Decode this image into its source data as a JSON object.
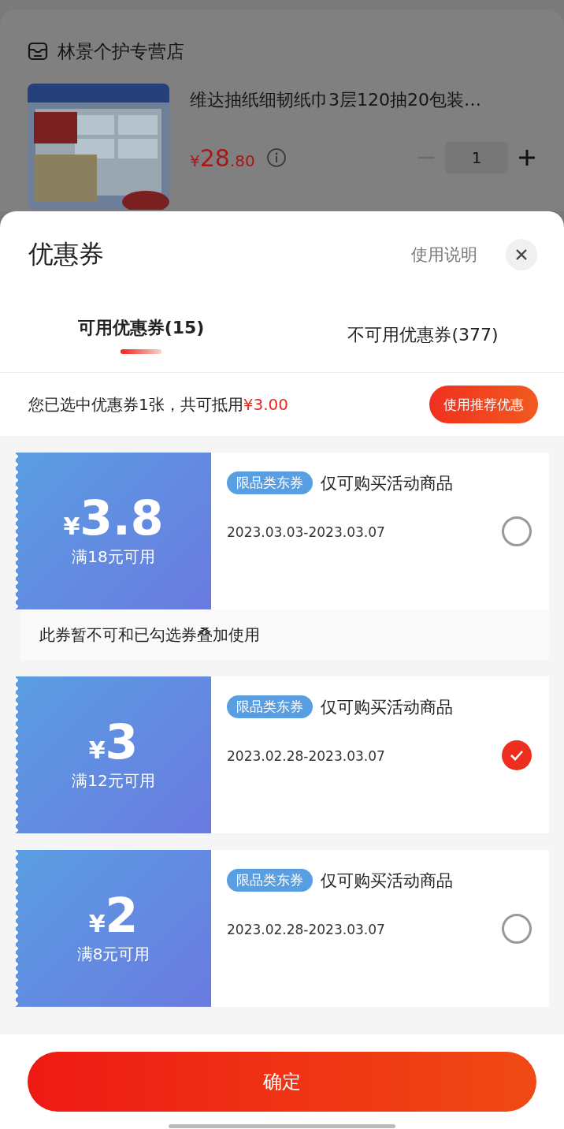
{
  "store": {
    "name": "林景个护专营店"
  },
  "product": {
    "title": "维达抽纸细韧纸巾3层120抽20包装…",
    "currency": "¥",
    "price_int": "28",
    "price_dec": ".80",
    "quantity": "1"
  },
  "sheet": {
    "title": "优惠券",
    "help_link": "使用说明"
  },
  "tabs": [
    {
      "label": "可用优惠券(15)",
      "selected": true
    },
    {
      "label": "不可用优惠券(377)",
      "selected": false
    }
  ],
  "summary": {
    "text": "您已选中优惠券1张，共可抵用",
    "amount": "¥3.00",
    "button": "使用推荐优惠"
  },
  "coupons": [
    {
      "currency": "¥",
      "amount": "3.8",
      "condition": "满18元可用",
      "tag": "限品类东券",
      "scope": "仅可购买活动商品",
      "dates": "2023.03.03-2023.03.07",
      "selected": false,
      "note": "此券暂不可和已勾选券叠加使用"
    },
    {
      "currency": "¥",
      "amount": "3",
      "condition": "满12元可用",
      "tag": "限品类东券",
      "scope": "仅可购买活动商品",
      "dates": "2023.02.28-2023.03.07",
      "selected": true
    },
    {
      "currency": "¥",
      "amount": "2",
      "condition": "满8元可用",
      "tag": "限品类东券",
      "scope": "仅可购买活动商品",
      "dates": "2023.02.28-2023.03.07",
      "selected": false
    }
  ],
  "confirm_button": "确定"
}
